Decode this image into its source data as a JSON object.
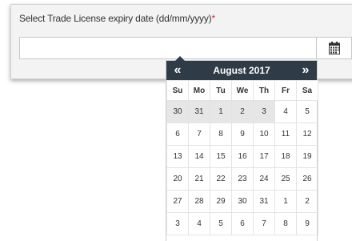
{
  "form": {
    "label": "Select Trade License expiry date (dd/mm/yyyy)",
    "required_mark": "*",
    "date_value": "",
    "calendar_icon": "calendar-icon"
  },
  "datepicker": {
    "prev": "«",
    "next": "»",
    "title": "August 2017",
    "weekdays": [
      "Su",
      "Mo",
      "Tu",
      "We",
      "Th",
      "Fr",
      "Sa"
    ],
    "weeks": [
      [
        "30",
        "31",
        "1",
        "2",
        "3",
        "4",
        "5"
      ],
      [
        "6",
        "7",
        "8",
        "9",
        "10",
        "11",
        "12"
      ],
      [
        "13",
        "14",
        "15",
        "16",
        "17",
        "18",
        "19"
      ],
      [
        "20",
        "21",
        "22",
        "23",
        "24",
        "25",
        "26"
      ],
      [
        "27",
        "28",
        "29",
        "30",
        "31",
        "1",
        "2"
      ],
      [
        "3",
        "4",
        "5",
        "6",
        "7",
        "8",
        "9"
      ]
    ],
    "highlighted_week_index": 0,
    "highlighted_days": [
      "30",
      "31",
      "1",
      "2",
      "3"
    ]
  },
  "colors": {
    "header_bg": "#2f3b47",
    "highlight_bg": "#e6e6e6",
    "required": "#e0272c"
  }
}
